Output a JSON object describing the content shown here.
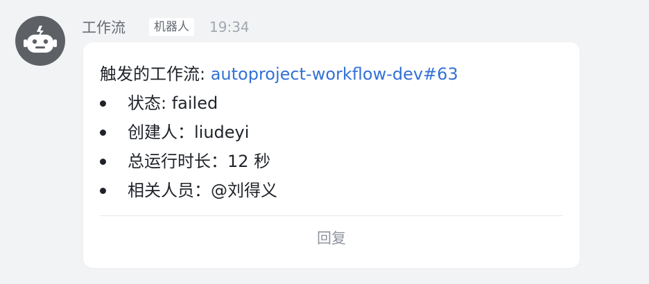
{
  "sender": {
    "name": "工作流",
    "tag": "机器人",
    "time": "19:34",
    "avatar_icon": "robot-icon",
    "avatar_color": "#5d6166"
  },
  "message": {
    "title_prefix": "触发的工作流: ",
    "workflow_link": "autoproject-workflow-dev#63",
    "link_color": "#3371d6",
    "items": [
      {
        "label": "状态: ",
        "value": "failed"
      },
      {
        "label": "创建人：",
        "value": "liudeyi"
      },
      {
        "label": "总运行时长：",
        "value": "12 秒"
      },
      {
        "label": "相关人员：",
        "value": "@刘得义"
      }
    ]
  },
  "actions": {
    "reply_label": "回复"
  }
}
